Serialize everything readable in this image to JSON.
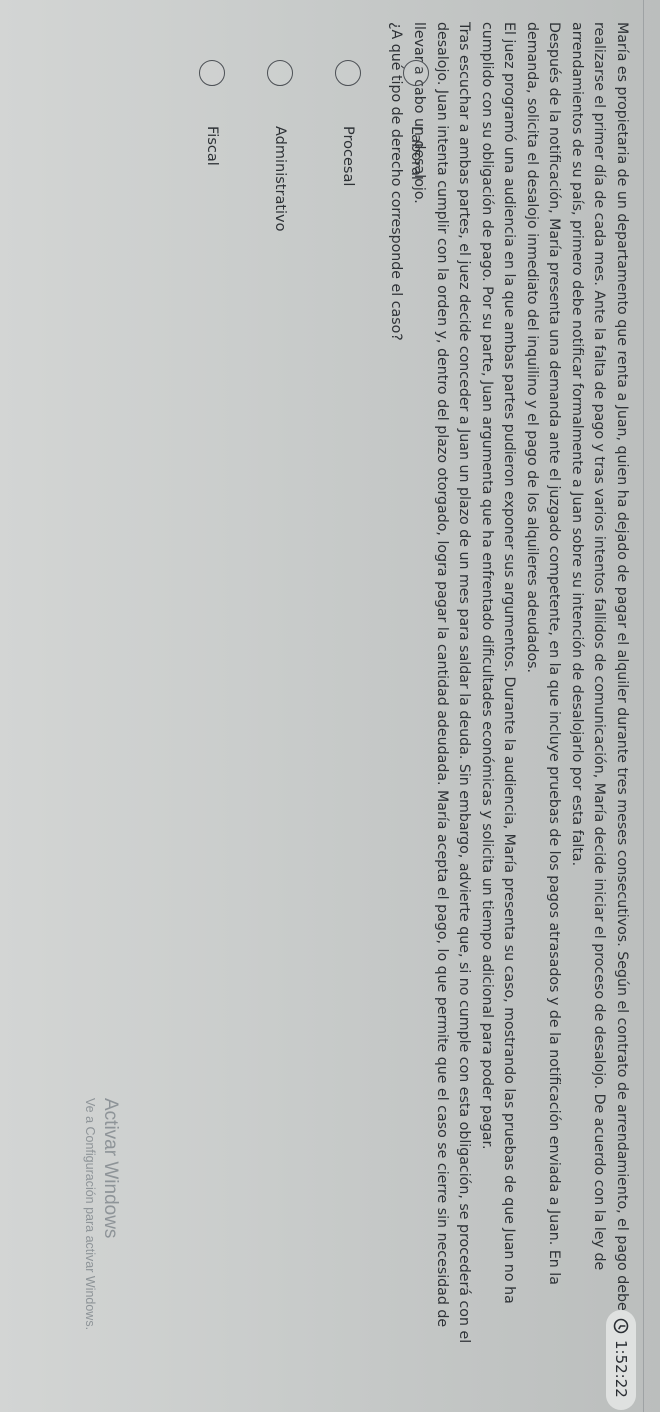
{
  "timer": {
    "icon": "clock-icon",
    "value": "1:52:22"
  },
  "question": {
    "paragraphs": [
      "María es propietaria de un departamento que renta a Juan, quien ha dejado de pagar el alquiler durante tres meses consecutivos. Según el contrato de arrendamiento, el pago debe realizarse el primer día de cada mes. Ante la falta de pago y tras varios intentos fallidos de comunicación, María decide iniciar el proceso de desalojo. De acuerdo con la ley de arrendamientos de su país, primero debe notificar formalmente a Juan sobre su intención de desalojarlo por esta falta.",
      "Después de la notificación, María presenta una demanda ante el juzgado competente, en la que incluye pruebas de los pagos atrasados y de la notificación enviada a Juan. En la demanda, solicita el desalojo inmediato del inquilino y el pago de los alquileres adeudados.",
      "El juez programó una audiencia en la que ambas partes pudieron exponer sus argumentos. Durante la audiencia, María presenta su caso, mostrando las pruebas de que Juan no ha cumplido con su obligación de pago. Por su parte, Juan argumenta que ha enfrentado dificultades económicas y solicita un tiempo adicional para poder pagar.",
      "Tras escuchar a ambas partes, el juez decide conceder a Juan un plazo de un mes para saldar la deuda. Sin embargo, advierte que, si no cumple con esta obligación, se procederá con el desalojo. Juan intenta cumplir con la orden y, dentro del plazo otorgado, logra pagar la cantidad adeudada. María acepta el pago, lo que permite que el caso se cierre sin necesidad de llevar a cabo un desalojo."
    ],
    "prompt": "¿A qué tipo de derecho corresponde el caso?"
  },
  "options": [
    {
      "label": "Laboral",
      "selected": false
    },
    {
      "label": "Procesal",
      "selected": false
    },
    {
      "label": "Administrativo",
      "selected": false
    },
    {
      "label": "Fiscal",
      "selected": false
    }
  ],
  "activation": {
    "title": "Activar Windows",
    "subtitle": "Ve a Configuración para activar Windows."
  }
}
